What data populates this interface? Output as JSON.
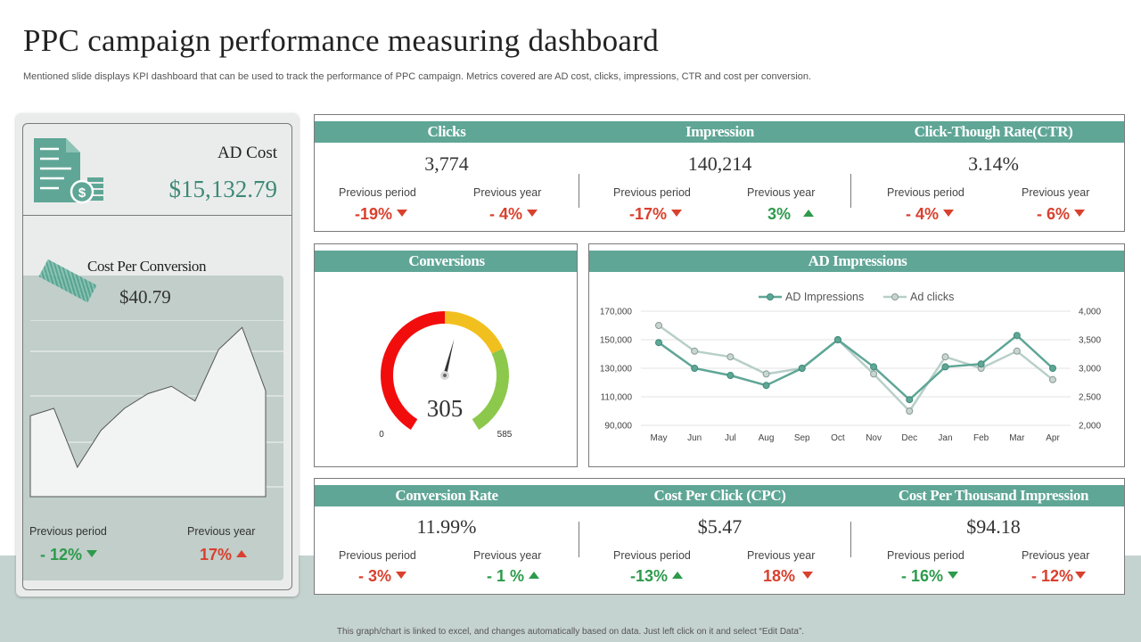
{
  "header": {
    "title": "PPC campaign performance measuring dashboard",
    "subtitle": "Mentioned slide displays KPI dashboard that can be used to track the performance of PPC campaign. Metrics covered are AD  cost, clicks, impressions, CTR and cost per conversion."
  },
  "footer": {
    "note": "This graph/chart is linked to excel, and changes automatically based on data.  Just left click on it and select “Edit Data”."
  },
  "left": {
    "ad_cost_label": "AD Cost",
    "ad_cost_value": "$15,132.79",
    "cpc_label": "Cost Per Conversion",
    "cpc_value": "$40.79",
    "prev_period_label": "Previous period",
    "prev_year_label": "Previous year",
    "prev_period_value": "- 12%",
    "prev_year_value": "17%",
    "sparkline": [
      55,
      60,
      20,
      45,
      60,
      70,
      75,
      65,
      100,
      115,
      72
    ]
  },
  "top": {
    "metrics": [
      {
        "title": "Clicks",
        "value": "3,774",
        "pp_label": "Previous period",
        "py_label": "Previous year",
        "pp": "-19%",
        "py": "- 4%"
      },
      {
        "title": "Impression",
        "value": "140,214",
        "pp_label": "Previous period",
        "py_label": "Previous year",
        "pp": "-17%",
        "py": "3%"
      },
      {
        "title": "Click-Though Rate(CTR)",
        "value": "3.14%",
        "pp_label": "Previous period",
        "py_label": "Previous year",
        "pp": "- 4%",
        "py": "- 6%"
      }
    ]
  },
  "conversions": {
    "title": "Conversions",
    "value": "305",
    "min": "0",
    "max": "585",
    "gauge_value": 305,
    "gauge_max": 585
  },
  "impressions_panel": {
    "title": "AD Impressions"
  },
  "bottom": {
    "metrics": [
      {
        "title": "Conversion Rate",
        "value": "11.99%",
        "pp_label": "Previous period",
        "py_label": "Previous year",
        "pp": "- 3%",
        "py": "- 1 %"
      },
      {
        "title": "Cost Per Click (CPC)",
        "value": "$5.47",
        "pp_label": "Previous period",
        "py_label": "Previous year",
        "pp": "-13%",
        "py": "18%"
      },
      {
        "title": "Cost Per Thousand Impression",
        "value": "$94.18",
        "pp_label": "Previous period",
        "py_label": "Previous year",
        "pp": "- 16%",
        "py": "- 12%"
      }
    ]
  },
  "colors": {
    "accent": "#5fa696",
    "dark_accent": "#3d8a78",
    "red": "#d9402e",
    "green": "#2e9a4c",
    "light_series": "#b8cfc9"
  },
  "chart_data": {
    "type": "line",
    "title": "",
    "categories": [
      "May",
      "Jun",
      "Jul",
      "Aug",
      "Sep",
      "Oct",
      "Nov",
      "Dec",
      "Jan",
      "Feb",
      "Mar",
      "Apr"
    ],
    "series": [
      {
        "name": "AD Impressions",
        "axis": "left",
        "values": [
          148000,
          130000,
          125000,
          118000,
          130000,
          150000,
          131000,
          108000,
          131000,
          133000,
          153000,
          130000
        ]
      },
      {
        "name": "Ad clicks",
        "axis": "right",
        "values": [
          3750,
          3300,
          3200,
          2900,
          3000,
          3500,
          2900,
          2250,
          3200,
          3000,
          3300,
          2800
        ]
      }
    ],
    "y_left": {
      "ticks": [
        "90,000",
        "110,000",
        "130,000",
        "150,000",
        "170,000"
      ],
      "range": [
        90000,
        170000
      ]
    },
    "y_right": {
      "ticks": [
        "2,000",
        "2,500",
        "3,000",
        "3,500",
        "4,000"
      ],
      "range": [
        2000,
        4000
      ]
    },
    "legend": "top-center",
    "grid": true
  }
}
